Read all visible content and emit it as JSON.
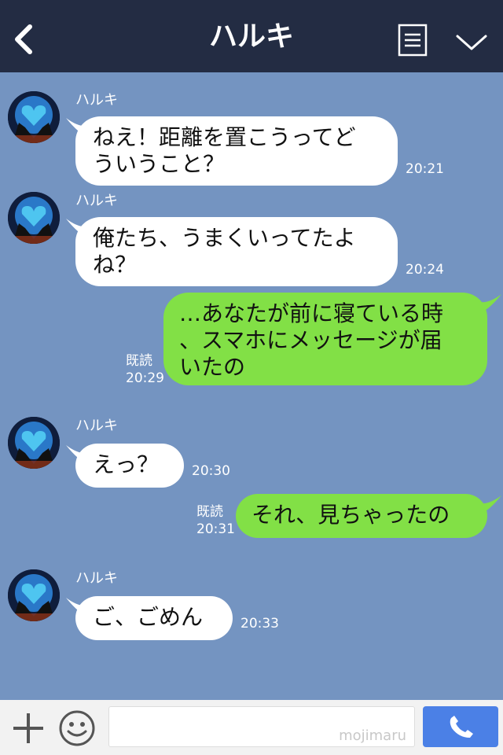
{
  "header": {
    "title": "ハルキ",
    "back_icon": "chevron-left-icon",
    "menu_icon": "list-icon",
    "expand_icon": "chevron-down-icon"
  },
  "messages": [
    {
      "direction": "in",
      "sender": "ハルキ",
      "lines": [
        "ねえ！距離を置こうってど",
        "ういうこと？"
      ],
      "time": "20:21"
    },
    {
      "direction": "in",
      "sender": "ハルキ",
      "lines": [
        "俺たち、うまくいってたよ",
        "ね？"
      ],
      "time": "20:24"
    },
    {
      "direction": "out",
      "lines": [
        "…あなたが前に寝ている時",
        "、スマホにメッセージが届",
        "いたの"
      ],
      "read": "既読",
      "time": "20:29"
    },
    {
      "direction": "in",
      "sender": "ハルキ",
      "lines": [
        "えっ？"
      ],
      "time": "20:30"
    },
    {
      "direction": "out",
      "lines": [
        "それ、見ちゃったの"
      ],
      "read": "既読",
      "time": "20:31"
    },
    {
      "direction": "in",
      "sender": "ハルキ",
      "lines": [
        "ご、ごめん"
      ],
      "time": "20:33"
    }
  ],
  "input_bar": {
    "plus_icon": "plus-icon",
    "sticker_icon": "smiley-icon",
    "watermark": "mojimaru",
    "call_icon": "phone-icon"
  },
  "colors": {
    "header_bg": "#232c43",
    "chat_bg": "#7494c1",
    "incoming_bubble": "#ffffff",
    "outgoing_bubble": "#82e046",
    "call_button": "#4b80e6"
  }
}
